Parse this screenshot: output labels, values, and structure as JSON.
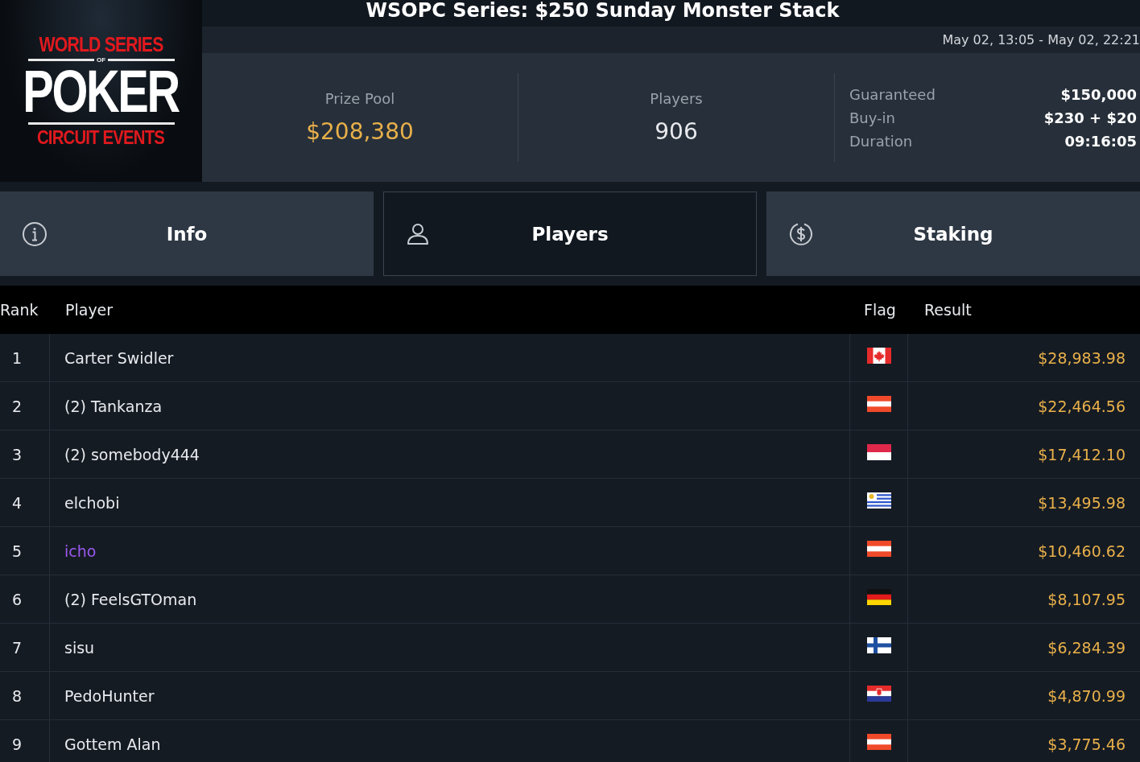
{
  "logo": {
    "top": "WORLD SERIES",
    "middle": "OF",
    "main": "POKER",
    "bottom": "CIRCUIT EVENTS"
  },
  "title": "WSOPC Series: $250 Sunday Monster Stack",
  "dates": "May 02, 13:05 - May 02, 22:21",
  "stats": [
    {
      "label": "Prize Pool",
      "value": "$208,380",
      "kind": "money"
    },
    {
      "label": "Players",
      "value": "906",
      "kind": "count"
    }
  ],
  "details": [
    {
      "label": "Guaranteed",
      "value": "$150,000"
    },
    {
      "label": "Buy-in",
      "value": "$230 + $20"
    },
    {
      "label": "Duration",
      "value": "09:16:05"
    }
  ],
  "tabs": [
    {
      "label": "Info",
      "kind": "info",
      "selected": false
    },
    {
      "label": "Players",
      "kind": "person",
      "selected": true
    },
    {
      "label": "Staking",
      "kind": "dollar",
      "selected": false
    }
  ],
  "table": {
    "columns": [
      "Rank",
      "Player",
      "Flag",
      "Result"
    ],
    "rows": [
      {
        "rank": "1",
        "player": "Carter Swidler",
        "highlighted": false,
        "kind": "canada",
        "result": "$28,983.98"
      },
      {
        "rank": "2",
        "player": "(2) Tankanza",
        "highlighted": false,
        "kind": "austria",
        "result": "$22,464.56"
      },
      {
        "rank": "3",
        "player": "(2) somebody444",
        "highlighted": false,
        "kind": "indonesia",
        "result": "$17,412.10"
      },
      {
        "rank": "4",
        "player": "elchobi",
        "highlighted": false,
        "kind": "uruguay",
        "result": "$13,495.98"
      },
      {
        "rank": "5",
        "player": "icho",
        "highlighted": true,
        "kind": "austria",
        "result": "$10,460.62"
      },
      {
        "rank": "6",
        "player": "(2) FeelsGTOman",
        "highlighted": false,
        "kind": "germany",
        "result": "$8,107.95"
      },
      {
        "rank": "7",
        "player": "sisu",
        "highlighted": false,
        "kind": "finland",
        "result": "$6,284.39"
      },
      {
        "rank": "8",
        "player": "PedoHunter",
        "highlighted": false,
        "kind": "croatia",
        "result": "$4,870.99"
      },
      {
        "rank": "9",
        "player": "Gottem Alan",
        "highlighted": false,
        "kind": "austria",
        "result": "$3,775.46"
      }
    ]
  }
}
